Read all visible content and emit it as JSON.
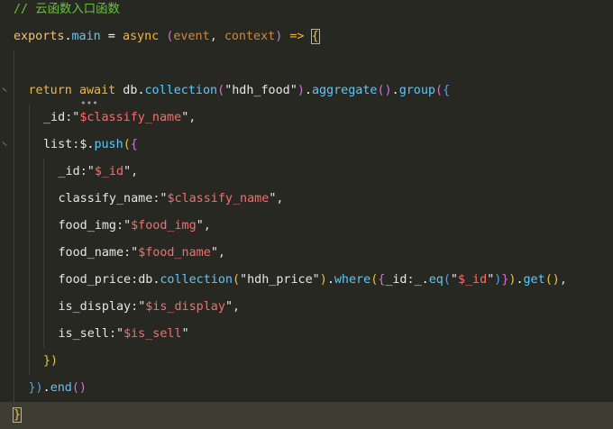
{
  "editor": {
    "theme_colors": {
      "background": "#272822",
      "current_line": "#3e3d32",
      "comment": "#67c23a",
      "keyword": "#f0b73d",
      "property": "#5ac8ff",
      "string": "#ff6a6a",
      "parameter": "#d0873c",
      "bracket_purple": "#d073d8",
      "bracket_blue": "#4aa3f5",
      "bracket_gold": "#e8c33b"
    },
    "lines": [
      {
        "indent": 0,
        "tokens": [
          {
            "t": "// 云函数入口函数",
            "c": "comment"
          }
        ]
      },
      {
        "indent": 0,
        "tokens": [
          {
            "t": "exports",
            "c": "var"
          },
          {
            "t": ".",
            "c": "op"
          },
          {
            "t": "main",
            "c": "prop"
          },
          {
            "t": " = ",
            "c": "op"
          },
          {
            "t": "async",
            "c": "kw"
          },
          {
            "t": " ",
            "c": "op"
          },
          {
            "t": "(",
            "c": "paren2"
          },
          {
            "t": "event",
            "c": "param"
          },
          {
            "t": ", ",
            "c": "punct"
          },
          {
            "t": "context",
            "c": "param"
          },
          {
            "t": ")",
            "c": "paren2"
          },
          {
            "t": " => ",
            "c": "kw"
          },
          {
            "t": "{",
            "c": "paren1",
            "box": true
          }
        ]
      },
      {
        "indent": 1,
        "tokens": []
      },
      {
        "indent": 1,
        "tokens": [
          {
            "t": "return",
            "c": "kw"
          },
          {
            "t": " ",
            "c": "op"
          },
          {
            "t": "await",
            "c": "kw"
          },
          {
            "t": " db",
            "c": "text"
          },
          {
            "t": ".",
            "c": "op"
          },
          {
            "t": "collection",
            "c": "prop"
          },
          {
            "t": "(",
            "c": "paren2"
          },
          {
            "t": "\"hdh_food\"",
            "c": "text"
          },
          {
            "t": ")",
            "c": "paren2"
          },
          {
            "t": ".",
            "c": "op"
          },
          {
            "t": "aggregate",
            "c": "prop"
          },
          {
            "t": "()",
            "c": "paren2"
          },
          {
            "t": ".",
            "c": "op"
          },
          {
            "t": "group",
            "c": "prop"
          },
          {
            "t": "(",
            "c": "paren2"
          },
          {
            "t": "{",
            "c": "paren3"
          }
        ]
      },
      {
        "indent": 2,
        "tokens": [
          {
            "t": "_id",
            "c": "text"
          },
          {
            "t": ":",
            "c": "punct"
          },
          {
            "t": "\"",
            "c": "text"
          },
          {
            "t": "$classify_name",
            "c": "str"
          },
          {
            "t": "\"",
            "c": "text"
          },
          {
            "t": ",",
            "c": "punct"
          }
        ]
      },
      {
        "indent": 2,
        "tokens": [
          {
            "t": "list",
            "c": "text"
          },
          {
            "t": ":",
            "c": "punct"
          },
          {
            "t": "$",
            "c": "text"
          },
          {
            "t": ".",
            "c": "op"
          },
          {
            "t": "push",
            "c": "prop"
          },
          {
            "t": "(",
            "c": "paren1"
          },
          {
            "t": "{",
            "c": "paren2"
          }
        ]
      },
      {
        "indent": 3,
        "tokens": [
          {
            "t": "_id",
            "c": "text"
          },
          {
            "t": ":",
            "c": "punct"
          },
          {
            "t": "\"",
            "c": "text"
          },
          {
            "t": "$_id",
            "c": "str"
          },
          {
            "t": "\"",
            "c": "text"
          },
          {
            "t": ",",
            "c": "punct"
          }
        ]
      },
      {
        "indent": 3,
        "tokens": [
          {
            "t": "classify_name",
            "c": "text"
          },
          {
            "t": ":",
            "c": "punct"
          },
          {
            "t": "\"",
            "c": "text"
          },
          {
            "t": "$classify_name",
            "c": "str"
          },
          {
            "t": "\"",
            "c": "text"
          },
          {
            "t": ",",
            "c": "punct"
          }
        ]
      },
      {
        "indent": 3,
        "tokens": [
          {
            "t": "food_img",
            "c": "text"
          },
          {
            "t": ":",
            "c": "punct"
          },
          {
            "t": "\"",
            "c": "text"
          },
          {
            "t": "$food_img",
            "c": "str"
          },
          {
            "t": "\"",
            "c": "text"
          },
          {
            "t": ",",
            "c": "punct"
          }
        ]
      },
      {
        "indent": 3,
        "tokens": [
          {
            "t": "food_name",
            "c": "text"
          },
          {
            "t": ":",
            "c": "punct"
          },
          {
            "t": "\"",
            "c": "text"
          },
          {
            "t": "$food_name",
            "c": "str"
          },
          {
            "t": "\"",
            "c": "text"
          },
          {
            "t": ",",
            "c": "punct"
          }
        ]
      },
      {
        "indent": 3,
        "tokens": [
          {
            "t": "food_price",
            "c": "text"
          },
          {
            "t": ":",
            "c": "punct"
          },
          {
            "t": "db",
            "c": "text"
          },
          {
            "t": ".",
            "c": "op"
          },
          {
            "t": "collection",
            "c": "prop"
          },
          {
            "t": "(",
            "c": "paren1"
          },
          {
            "t": "\"hdh_price\"",
            "c": "text"
          },
          {
            "t": ")",
            "c": "paren1"
          },
          {
            "t": ".",
            "c": "op"
          },
          {
            "t": "where",
            "c": "prop"
          },
          {
            "t": "(",
            "c": "paren1"
          },
          {
            "t": "{",
            "c": "paren2"
          },
          {
            "t": "_id",
            "c": "text"
          },
          {
            "t": ":",
            "c": "punct"
          },
          {
            "t": "_",
            "c": "text"
          },
          {
            "t": ".",
            "c": "op"
          },
          {
            "t": "eq",
            "c": "prop"
          },
          {
            "t": "(",
            "c": "paren3"
          },
          {
            "t": "\"",
            "c": "text"
          },
          {
            "t": "$_id",
            "c": "str"
          },
          {
            "t": "\"",
            "c": "text"
          },
          {
            "t": ")",
            "c": "paren3"
          },
          {
            "t": "}",
            "c": "paren2"
          },
          {
            "t": ")",
            "c": "paren1"
          },
          {
            "t": ".",
            "c": "op"
          },
          {
            "t": "get",
            "c": "prop"
          },
          {
            "t": "()",
            "c": "paren1"
          },
          {
            "t": ",",
            "c": "punct"
          }
        ]
      },
      {
        "indent": 3,
        "tokens": [
          {
            "t": "is_display",
            "c": "text"
          },
          {
            "t": ":",
            "c": "punct"
          },
          {
            "t": "\"",
            "c": "text"
          },
          {
            "t": "$is_display",
            "c": "str"
          },
          {
            "t": "\"",
            "c": "text"
          },
          {
            "t": ",",
            "c": "punct"
          }
        ]
      },
      {
        "indent": 3,
        "tokens": [
          {
            "t": "is_sell",
            "c": "text"
          },
          {
            "t": ":",
            "c": "punct"
          },
          {
            "t": "\"",
            "c": "text"
          },
          {
            "t": "$is_sell",
            "c": "str"
          },
          {
            "t": "\"",
            "c": "text"
          }
        ]
      },
      {
        "indent": 2,
        "tokens": [
          {
            "t": "})",
            "c": "paren1"
          }
        ]
      },
      {
        "indent": 1,
        "tokens": [
          {
            "t": "})",
            "c": "paren3"
          },
          {
            "t": ".",
            "c": "op"
          },
          {
            "t": "end",
            "c": "prop"
          },
          {
            "t": "()",
            "c": "paren2"
          }
        ]
      },
      {
        "indent": 0,
        "current": true,
        "tokens": [
          {
            "t": "}",
            "c": "paren1",
            "box": true
          }
        ]
      }
    ]
  }
}
